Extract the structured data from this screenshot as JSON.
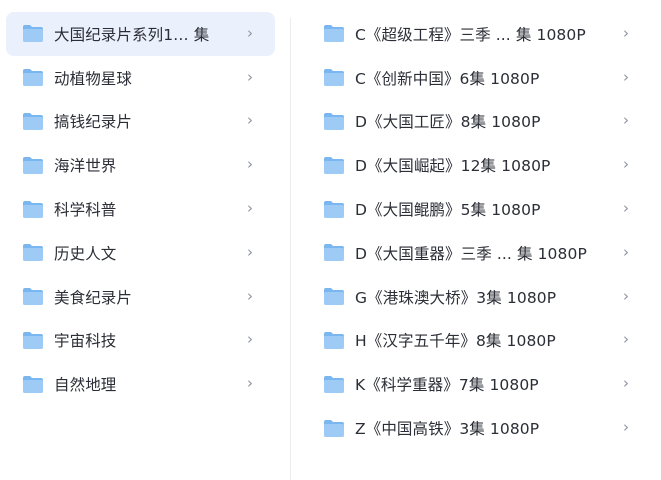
{
  "colors": {
    "folder_back": "#7ab6ef",
    "folder_front": "#9dcbf6",
    "selected_bg": "#ebf0fd",
    "text": "#2b2e36",
    "chevron": "#8d93a0"
  },
  "chevron_glyph": "›",
  "left_folders": [
    {
      "label": "大国纪录片系列1… 集",
      "selected": true
    },
    {
      "label": "动植物星球"
    },
    {
      "label": "搞钱纪录片"
    },
    {
      "label": "海洋世界"
    },
    {
      "label": "科学科普"
    },
    {
      "label": "历史人文"
    },
    {
      "label": "美食纪录片"
    },
    {
      "label": "宇宙科技"
    },
    {
      "label": "自然地理"
    }
  ],
  "right_folders": [
    {
      "label": "C《超级工程》三季 ... 集 1080P"
    },
    {
      "label": "C《创新中国》6集 1080P"
    },
    {
      "label": "D《大国工匠》8集 1080P"
    },
    {
      "label": "D《大国崛起》12集 1080P"
    },
    {
      "label": "D《大国鲲鹏》5集 1080P"
    },
    {
      "label": "D《大国重器》三季 ... 集 1080P"
    },
    {
      "label": "G《港珠澳大桥》3集 1080P"
    },
    {
      "label": "H《汉字五千年》8集 1080P"
    },
    {
      "label": "K《科学重器》7集 1080P"
    },
    {
      "label": "Z《中国高铁》3集 1080P"
    }
  ]
}
